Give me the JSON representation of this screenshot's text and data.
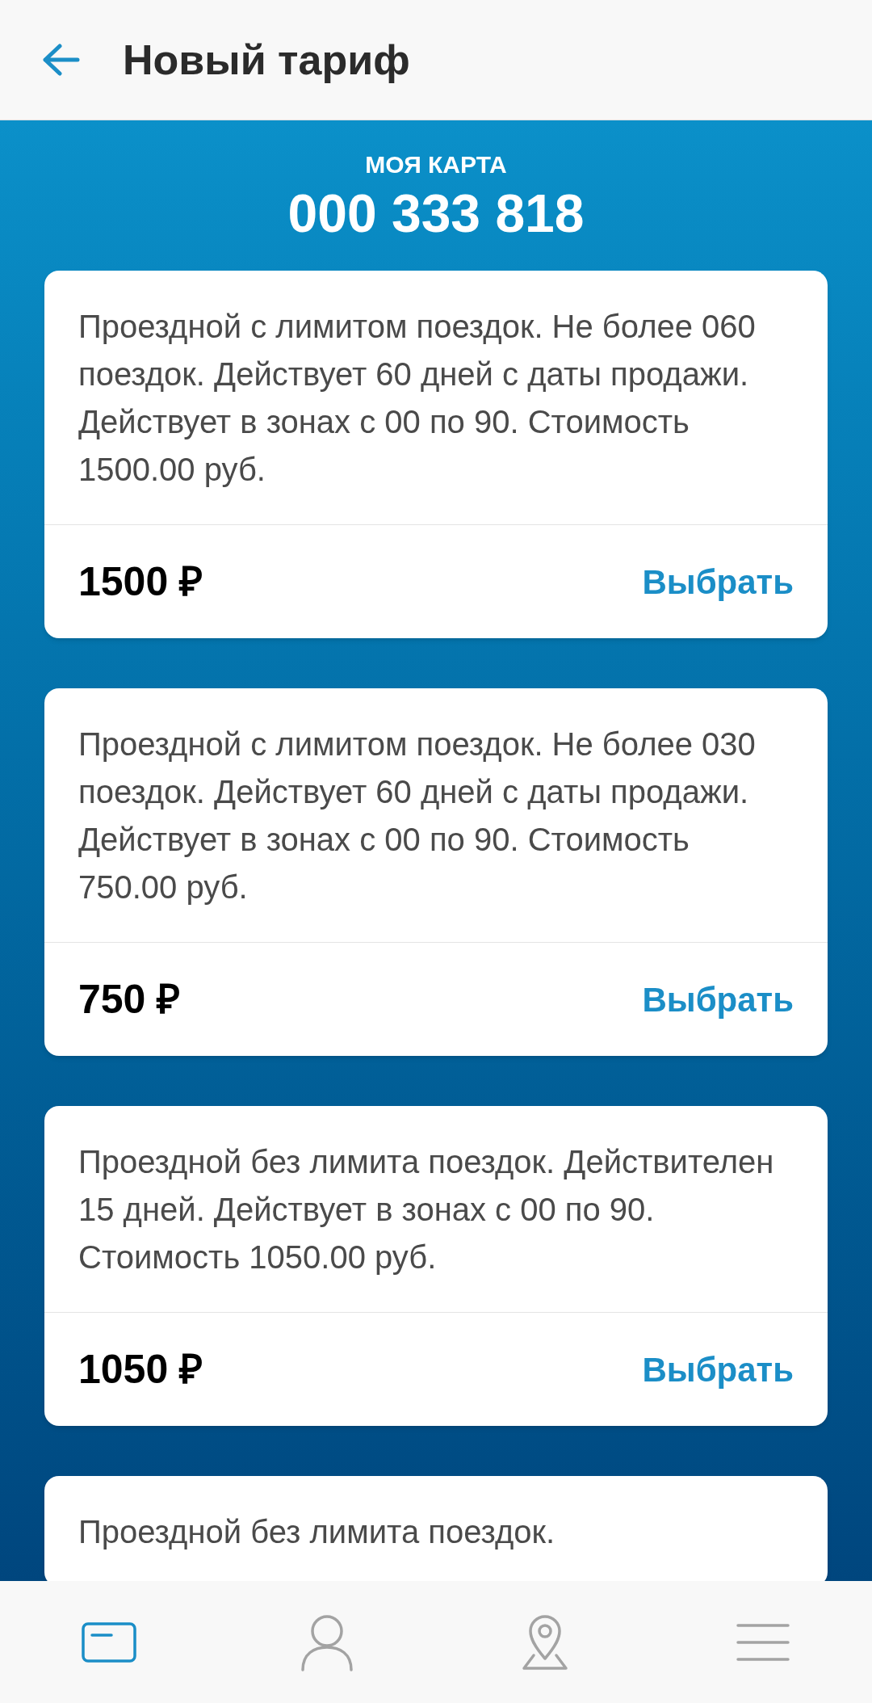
{
  "header": {
    "title": "Новый тариф"
  },
  "card_info": {
    "label": "МОЯ КАРТА",
    "number": "000 333 818"
  },
  "tariffs": [
    {
      "description": "Проездной с лимитом поездок. Не более 060 поездок. Действует 60 дней с даты продажи. Действует в зонах с 00 по 90. Стоимость 1500.00 руб.",
      "price": "1500 ₽",
      "action": "Выбрать"
    },
    {
      "description": "Проездной с лимитом поездок. Не более 030 поездок. Действует 60 дней с даты продажи. Действует в зонах с 00 по 90. Стоимость 750.00 руб.",
      "price": "750 ₽",
      "action": "Выбрать"
    },
    {
      "description": "Проездной без лимита поездок. Действителен 15 дней. Действует в зонах с 00 по 90. Стоимость 1050.00 руб.",
      "price": "1050 ₽",
      "action": "Выбрать"
    },
    {
      "description": "Проездной без лимита поездок."
    }
  ],
  "bottom_nav": [
    {
      "kind": "card",
      "selected": true
    },
    {
      "kind": "profile",
      "selected": false
    },
    {
      "kind": "map",
      "selected": false
    },
    {
      "kind": "menu",
      "selected": false
    }
  ]
}
